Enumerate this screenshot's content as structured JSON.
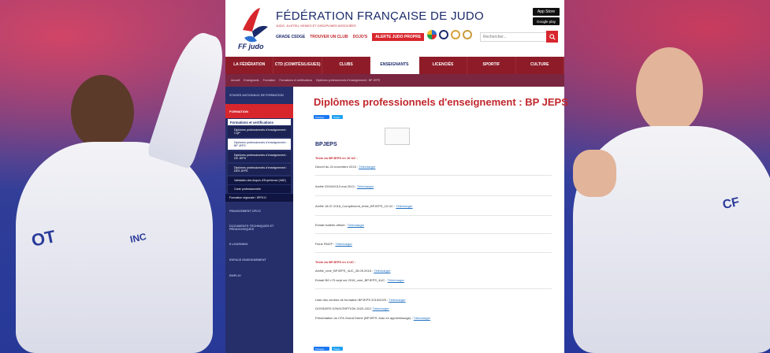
{
  "header": {
    "logo_text": "FF judo",
    "site_title": "FÉDÉRATION FRANÇAISE DE JUDO",
    "site_subtitle": "JUDO, JUJITSU, KENDO ET DISCIPLINES ASSOCIÉES",
    "quicklinks": [
      "GRADE CSDGE",
      "TROUVER UN CLUB",
      "DOJO'S"
    ],
    "alert_link": "ALERTE JUDO PROPRE",
    "appstore_label": "App Store",
    "gplay_label": "Google play",
    "search_placeholder": "Rechercher...",
    "search_icon": "search-icon"
  },
  "nav": {
    "items": [
      {
        "label": "LA FÉDÉRATION"
      },
      {
        "label": "CTD (COMITÉS/LIGUES)"
      },
      {
        "label": "CLUBS"
      },
      {
        "label": "ENSEIGNANTS"
      },
      {
        "label": "LICENCIÉS"
      },
      {
        "label": "SPORTIF"
      },
      {
        "label": "CULTURE"
      }
    ],
    "active_index": 3
  },
  "breadcrumb": [
    "Accueil",
    "Enseignants",
    "Formation",
    "Formations et certifications",
    "Diplômes professionnels d'enseignement : BP JEPS"
  ],
  "sidebar": {
    "top_item": "STAGES NATIONAUX DE FORMATION",
    "active_head": "FORMATION",
    "sub_head": "Formations et certifications",
    "subs": [
      "Diplômes professionnels d'enseignement : CQP",
      "Diplômes professionnels d'enseignement : BP JEPS",
      "Diplômes professionnels d'enseignement : DE JEPS",
      "Diplômes professionnels d'enseignement : DES JEPS",
      "Validation des Acquis d'Expérience (VAE)",
      "Carte professionnelle",
      "Formation régionale / IRFEJJ"
    ],
    "bottom_items": [
      "FINANCEMENT OPCO",
      "DOCUMENTS TECHNIQUES ET PÉDAGOGIQUES",
      "E-LEARNING",
      "ESPACE ENSEIGNEMENT",
      "EMPLOI"
    ]
  },
  "content": {
    "title": "Diplômes professionnels d'enseignement : BP JEPS",
    "share_fb": "Partager",
    "share_tw": "Tweet",
    "section_title": "BPJEPS",
    "download_label": "Télécharger",
    "texts_10uc_heading": "Texte du BPJEPS en 10 UC :",
    "lines_10uc": [
      "Décret du 24 novembre 2015 :",
      "Arrêté 29/04/2013 mai 2013 :",
      "Arrêté 18.07.2016_Complément_texte_BPJEPS_10 UC :",
      "Extrait bulletin officiel :",
      "Fiche RNCP :"
    ],
    "texts_4uc_heading": "Texte du BPJEPS en 4 UC :",
    "lines_4uc": [
      "Arrêté_cree_BPJEPS_4UC_28.09.2016 :",
      "Extrait BO n°5 sept oct 2016_cree_BPJEPS_4UC :"
    ],
    "lines_bottom": [
      "Liste des centres de formation BPJEPS 2019/2020 :",
      "DOSSIERS D'INSCRIPTION 2020-2021",
      "Présentation du CFA Grand Dôme (BPJEPS Judo en apprentissage) :"
    ]
  },
  "colors": {
    "brand_red": "#c1272d",
    "nav_bg": "#8e1c28",
    "sidebar_bg": "#262f6a",
    "link_blue": "#1f6fbf"
  }
}
